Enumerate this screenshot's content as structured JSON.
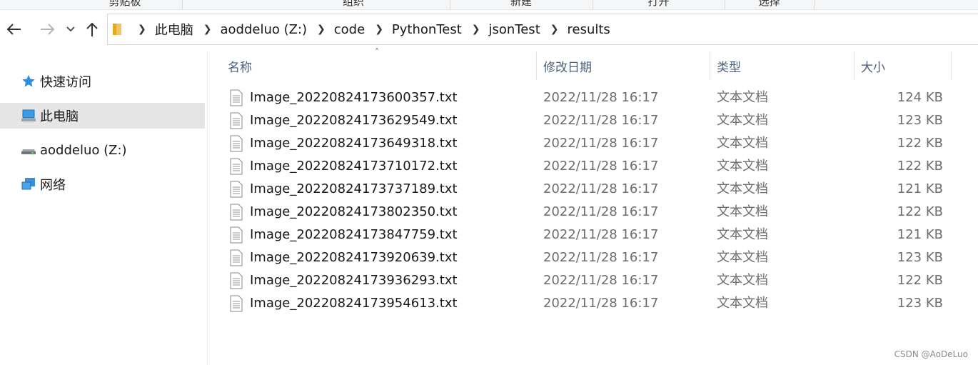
{
  "ribbon": {
    "groups": [
      "剪贴板",
      "组织",
      "新建",
      "打开",
      "选择"
    ]
  },
  "nav": {
    "back_icon": "arrow-left-icon",
    "forward_icon": "arrow-right-icon",
    "recent_icon": "chevron-down-icon",
    "up_icon": "arrow-up-icon"
  },
  "address": {
    "folder_icon": "folder-icon",
    "crumbs": [
      "此电脑",
      "aoddeluo (Z:)",
      "code",
      "PythonTest",
      "jsonTest",
      "results"
    ]
  },
  "sidebar": {
    "items": [
      {
        "label": "快速访问",
        "icon": "star-icon"
      },
      {
        "label": "此电脑",
        "icon": "computer-icon"
      },
      {
        "label": "aoddeluo (Z:)",
        "icon": "drive-icon"
      },
      {
        "label": "网络",
        "icon": "network-icon"
      }
    ],
    "selected_index": 1
  },
  "columns": {
    "name": "名称",
    "date": "修改日期",
    "type": "类型",
    "size": "大小"
  },
  "files": [
    {
      "name": "Image_20220824173600357.txt",
      "date": "2022/11/28 16:17",
      "type": "文本文档",
      "size": "124 KB"
    },
    {
      "name": "Image_20220824173629549.txt",
      "date": "2022/11/28 16:17",
      "type": "文本文档",
      "size": "123 KB"
    },
    {
      "name": "Image_20220824173649318.txt",
      "date": "2022/11/28 16:17",
      "type": "文本文档",
      "size": "122 KB"
    },
    {
      "name": "Image_20220824173710172.txt",
      "date": "2022/11/28 16:17",
      "type": "文本文档",
      "size": "122 KB"
    },
    {
      "name": "Image_20220824173737189.txt",
      "date": "2022/11/28 16:17",
      "type": "文本文档",
      "size": "121 KB"
    },
    {
      "name": "Image_20220824173802350.txt",
      "date": "2022/11/28 16:17",
      "type": "文本文档",
      "size": "122 KB"
    },
    {
      "name": "Image_20220824173847759.txt",
      "date": "2022/11/28 16:17",
      "type": "文本文档",
      "size": "121 KB"
    },
    {
      "name": "Image_20220824173920639.txt",
      "date": "2022/11/28 16:17",
      "type": "文本文档",
      "size": "123 KB"
    },
    {
      "name": "Image_20220824173936293.txt",
      "date": "2022/11/28 16:17",
      "type": "文本文档",
      "size": "122 KB"
    },
    {
      "name": "Image_20220824173954613.txt",
      "date": "2022/11/28 16:17",
      "type": "文本文档",
      "size": "123 KB"
    }
  ],
  "watermark": "CSDN @AoDeLuo",
  "colors": {
    "header_text": "#4c607a",
    "selected_bg": "#e5e5e5",
    "muted_text": "#6d6d6d"
  }
}
